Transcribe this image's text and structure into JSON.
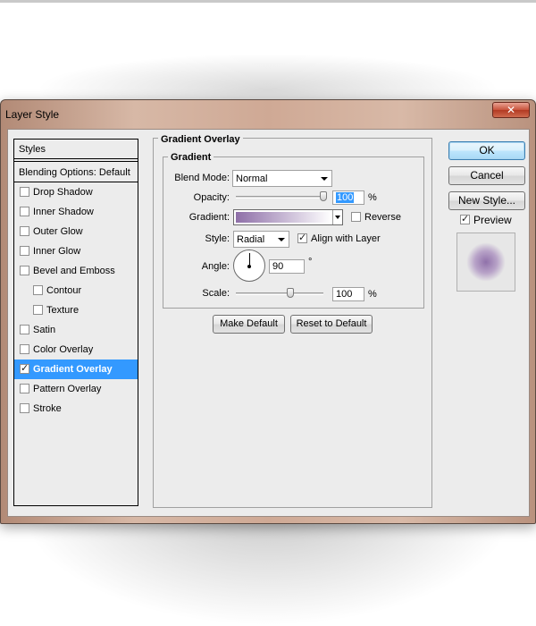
{
  "window": {
    "title": "Layer Style",
    "close_symbol": "✕"
  },
  "sidebar": {
    "header": "Styles",
    "blending_options": "Blending Options: Default",
    "items": [
      {
        "label": "Drop Shadow",
        "checked": false,
        "selected": false,
        "indent": 1
      },
      {
        "label": "Inner Shadow",
        "checked": false,
        "selected": false,
        "indent": 1
      },
      {
        "label": "Outer Glow",
        "checked": false,
        "selected": false,
        "indent": 1
      },
      {
        "label": "Inner Glow",
        "checked": false,
        "selected": false,
        "indent": 1
      },
      {
        "label": "Bevel and Emboss",
        "checked": false,
        "selected": false,
        "indent": 1
      },
      {
        "label": "Contour",
        "checked": false,
        "selected": false,
        "indent": 2
      },
      {
        "label": "Texture",
        "checked": false,
        "selected": false,
        "indent": 2
      },
      {
        "label": "Satin",
        "checked": false,
        "selected": false,
        "indent": 1
      },
      {
        "label": "Color Overlay",
        "checked": false,
        "selected": false,
        "indent": 1
      },
      {
        "label": "Gradient Overlay",
        "checked": true,
        "selected": true,
        "indent": 1
      },
      {
        "label": "Pattern Overlay",
        "checked": false,
        "selected": false,
        "indent": 1
      },
      {
        "label": "Stroke",
        "checked": false,
        "selected": false,
        "indent": 1
      }
    ]
  },
  "panel": {
    "section_title": "Gradient Overlay",
    "group_title": "Gradient",
    "blend_mode_label": "Blend Mode:",
    "blend_mode_value": "Normal",
    "opacity_label": "Opacity:",
    "opacity_value": "100",
    "opacity_unit": "%",
    "gradient_label": "Gradient:",
    "gradient_colors": [
      "#8e6fa8",
      "#ffffff"
    ],
    "reverse_label": "Reverse",
    "reverse_checked": false,
    "style_label": "Style:",
    "style_value": "Radial",
    "align_label": "Align with Layer",
    "align_checked": true,
    "angle_label": "Angle:",
    "angle_value": "90",
    "angle_unit": "°",
    "scale_label": "Scale:",
    "scale_value": "100",
    "scale_unit": "%",
    "make_default": "Make Default",
    "reset_default": "Reset to Default"
  },
  "actions": {
    "ok": "OK",
    "cancel": "Cancel",
    "new_style": "New Style...",
    "preview_label": "Preview",
    "preview_checked": true
  },
  "colors": {
    "selection": "#3399ff",
    "gradient_purple": "#8e6fa8",
    "title_bar": "#cfa995"
  }
}
